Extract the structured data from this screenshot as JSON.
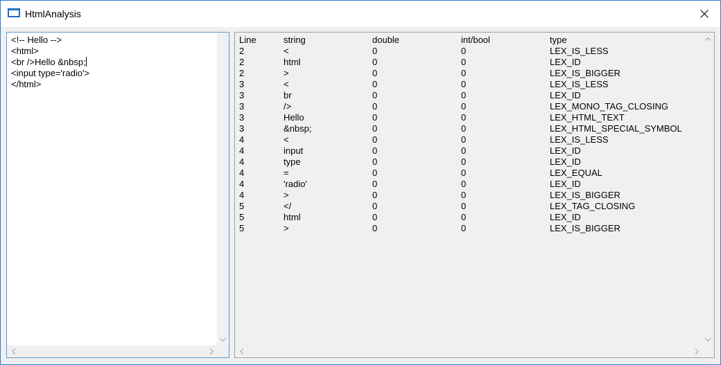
{
  "window": {
    "title": "HtmlAnalysis"
  },
  "editor": {
    "lines": [
      "<!-- Hello -->",
      "<html>",
      "<br />Hello &nbsp;",
      "<input type='radio'>",
      "</html>"
    ]
  },
  "table": {
    "headers": [
      "Line",
      "string",
      "double",
      "int/bool",
      "type"
    ],
    "rows": [
      [
        "2",
        "<",
        "0",
        "0",
        "LEX_IS_LESS"
      ],
      [
        "2",
        "html",
        "0",
        "0",
        "LEX_ID"
      ],
      [
        "2",
        ">",
        "0",
        "0",
        "LEX_IS_BIGGER"
      ],
      [
        "3",
        "<",
        "0",
        "0",
        "LEX_IS_LESS"
      ],
      [
        "3",
        "br",
        "0",
        "0",
        "LEX_ID"
      ],
      [
        "3",
        "/>",
        "0",
        "0",
        "LEX_MONO_TAG_CLOSING"
      ],
      [
        "3",
        "Hello",
        "0",
        "0",
        "LEX_HTML_TEXT"
      ],
      [
        "3",
        "&nbsp;",
        "0",
        "0",
        "LEX_HTML_SPECIAL_SYMBOL"
      ],
      [
        "4",
        "<",
        "0",
        "0",
        "LEX_IS_LESS"
      ],
      [
        "4",
        "input",
        "0",
        "0",
        "LEX_ID"
      ],
      [
        "4",
        "type",
        "0",
        "0",
        "LEX_ID"
      ],
      [
        "4",
        "=",
        "0",
        "0",
        "LEX_EQUAL"
      ],
      [
        "4",
        "'radio'",
        "0",
        "0",
        "LEX_ID"
      ],
      [
        "4",
        ">",
        "0",
        "0",
        "LEX_IS_BIGGER"
      ],
      [
        "5",
        "</",
        "0",
        "0",
        "LEX_TAG_CLOSING"
      ],
      [
        "5",
        "html",
        "0",
        "0",
        "LEX_ID"
      ],
      [
        "5",
        ">",
        "0",
        "0",
        "LEX_IS_BIGGER"
      ]
    ]
  },
  "icons": {
    "app": "window-icon",
    "close": "close-icon",
    "scroll_up": "chevron-up-icon",
    "scroll_down": "chevron-down-icon",
    "scroll_left": "chevron-left-icon",
    "scroll_right": "chevron-right-icon"
  },
  "colors": {
    "accent": "#2b79d0",
    "editor_border": "#5b9bd5",
    "panel_bg": "#f0f0f0"
  }
}
